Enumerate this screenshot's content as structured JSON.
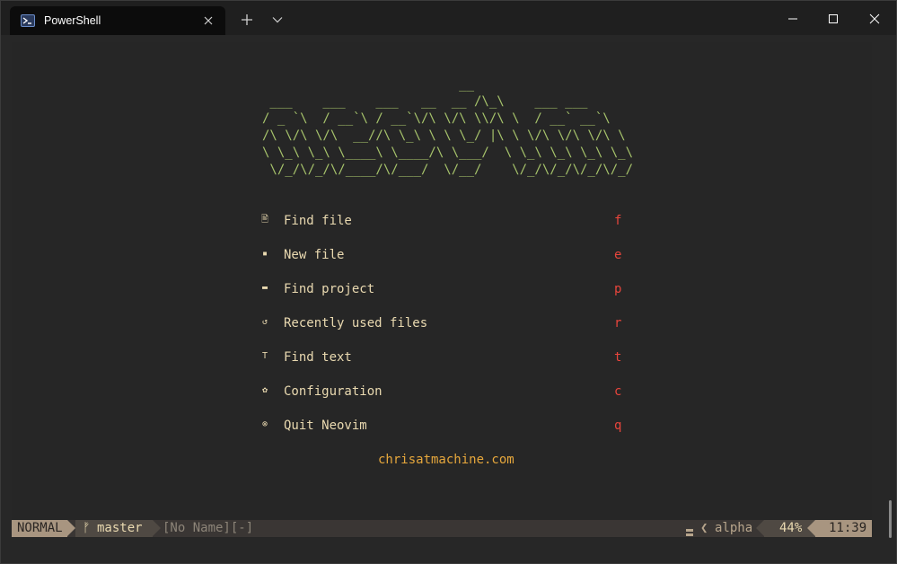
{
  "window": {
    "tab_title": "PowerShell",
    "tab_icon": "powershell-icon",
    "controls": [
      "minimize-icon",
      "maximize-icon",
      "close-icon"
    ]
  },
  "dashboard": {
    "ascii_header": "                          __\n ___    ___    ___   __  __ /\\_\\    ___ ___\n/ _ `\\  / __`\\ / __`\\/\\ \\/\\ \\\\/\\ \\  / __` __`\\\n/\\ \\/\\ \\/\\  __//\\ \\_\\ \\ \\ \\_/ |\\ \\ \\/\\ \\/\\ \\/\\ \\\n\\ \\_\\ \\_\\ \\____\\ \\____/\\ \\___/  \\ \\_\\ \\_\\ \\_\\ \\_\\\n \\/_/\\/_/\\/____/\\/___/  \\/__/    \\/_/\\/_/\\/_/\\/_/",
    "items": [
      {
        "icon": "search-file-icon",
        "glyph": "🖹",
        "label": "Find file",
        "key": "f"
      },
      {
        "icon": "new-file-icon",
        "glyph": "▪",
        "label": "New file",
        "key": "e"
      },
      {
        "icon": "folder-icon",
        "glyph": "▬",
        "label": "Find project",
        "key": "p"
      },
      {
        "icon": "history-icon",
        "glyph": "↺",
        "label": "Recently used files",
        "key": "r"
      },
      {
        "icon": "text-icon",
        "glyph": "T",
        "label": "Find text",
        "key": "t"
      },
      {
        "icon": "gear-icon",
        "glyph": "✿",
        "label": "Configuration",
        "key": "c"
      },
      {
        "icon": "power-icon",
        "glyph": "⊗",
        "label": "Quit Neovim",
        "key": "q"
      }
    ],
    "footer": "chrisatmachine.com"
  },
  "statusline": {
    "mode": "NORMAL",
    "branch_icon": "git-branch-icon",
    "branch": "master",
    "filename": "[No Name][-]",
    "filetype": "alpha",
    "percent": "44%",
    "time": "11:39"
  },
  "colors": {
    "ascii": "#a6c36b",
    "menu_text": "#e9d9b0",
    "shortcut_key": "#e8453c",
    "footer": "#e6a73c",
    "statusline_accent": "#a89580"
  }
}
